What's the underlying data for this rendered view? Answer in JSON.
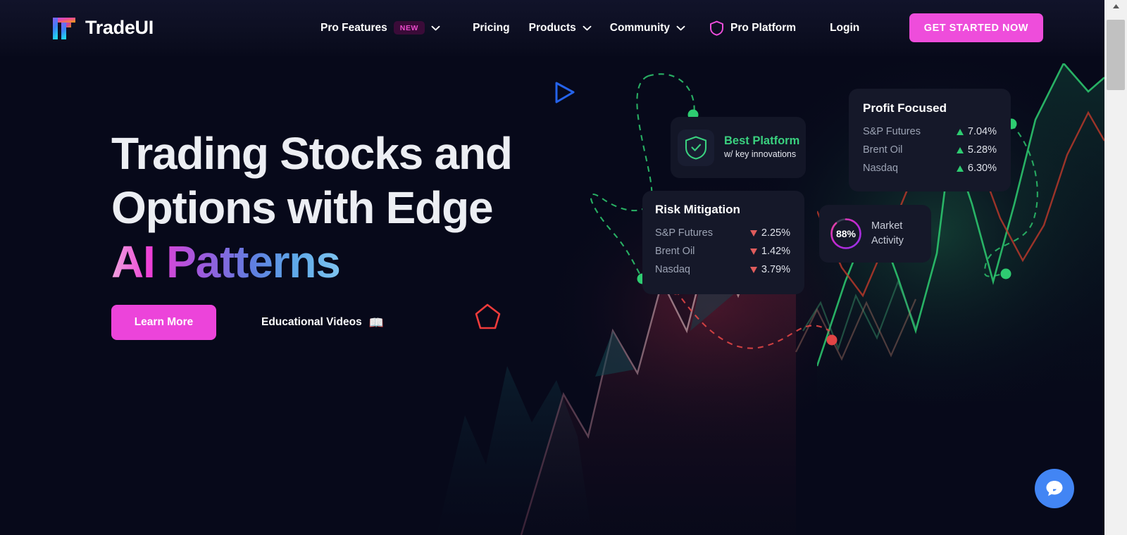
{
  "brand": {
    "name": "TradeUI",
    "logo_icon": "tradeui-logo-icon"
  },
  "nav": {
    "items": [
      {
        "label": "Pro Features",
        "badge": "NEW",
        "has_dropdown": true,
        "icon": null
      },
      {
        "label": "Pricing",
        "badge": null,
        "has_dropdown": false,
        "icon": null
      },
      {
        "label": "Products",
        "badge": null,
        "has_dropdown": true,
        "icon": null
      },
      {
        "label": "Community",
        "badge": null,
        "has_dropdown": true,
        "icon": null
      },
      {
        "label": "Pro Platform",
        "badge": null,
        "has_dropdown": false,
        "icon": "shield-icon"
      }
    ],
    "login_label": "Login",
    "cta_label": "GET STARTED NOW"
  },
  "hero": {
    "line1": "Trading Stocks and",
    "line2": "Options with Edge",
    "line3": "AI Patterns",
    "primary_button": "Learn More",
    "secondary_link": "Educational Videos",
    "secondary_icon": "open-book-icon"
  },
  "cards": {
    "best_platform": {
      "icon": "shield-check-icon",
      "title": "Best Platform",
      "subtitle": "w/ key innovations"
    },
    "profit_focused": {
      "title": "Profit Focused",
      "rows": [
        {
          "name": "S&P Futures",
          "direction": "up",
          "value": "7.04%"
        },
        {
          "name": "Brent Oil",
          "direction": "up",
          "value": "5.28%"
        },
        {
          "name": "Nasdaq",
          "direction": "up",
          "value": "6.30%"
        }
      ]
    },
    "risk_mitigation": {
      "title": "Risk Mitigation",
      "rows": [
        {
          "name": "S&P Futures",
          "direction": "down",
          "value": "2.25%"
        },
        {
          "name": "Brent Oil",
          "direction": "down",
          "value": "1.42%"
        },
        {
          "name": "Nasdaq",
          "direction": "down",
          "value": "3.79%"
        }
      ]
    },
    "market_activity": {
      "percent_label": "88%",
      "percent_value": 88,
      "label_line1": "Market",
      "label_line2": "Activity"
    }
  },
  "widgets": {
    "chat_icon": "chat-bubble-icon"
  },
  "colors": {
    "page_background": "#07091a",
    "nav_background": "#11132a",
    "accent_pink": "#ee4ddb",
    "gain_green": "#2ecc71",
    "loss_red": "#e05c5c",
    "card_background": "#151829",
    "chat_blue": "#4285f4",
    "text_primary": "#ffffff",
    "text_muted": "#9ca3b4"
  },
  "decor": {
    "play_triangle_color": "#2563eb",
    "pentagon_color": "#ef3b3b",
    "dashed_green": "#2ecc71",
    "dashed_red": "#e04545"
  }
}
